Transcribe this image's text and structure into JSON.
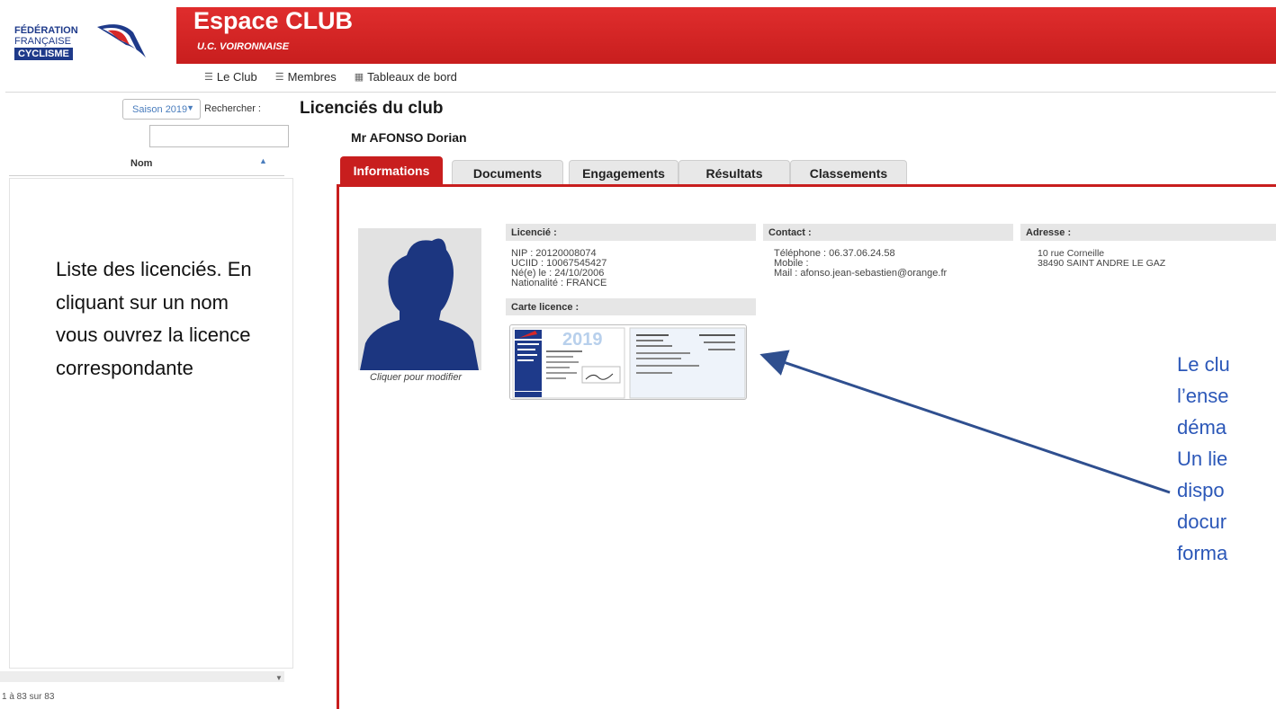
{
  "header": {
    "logo": {
      "line1": "FÉDÉRATION",
      "line2": "FRANÇAISE",
      "line3": "CYCLISME"
    },
    "title": "Espace CLUB",
    "subtitle": "U.C. VOIRONNAISE",
    "brand_color": "#c81e1e"
  },
  "nav": {
    "items": [
      {
        "label": "Le Club",
        "icon": "list-icon"
      },
      {
        "label": "Membres",
        "icon": "list-icon"
      },
      {
        "label": "Tableaux de bord",
        "icon": "grid-icon"
      }
    ]
  },
  "sidebar": {
    "season_select": "Saison 2019",
    "search_label": "Rechercher :",
    "search_value": "",
    "column_header": "Nom",
    "pager": "1 à 83 sur 83",
    "note": "Liste des licenciés. En cliquant sur un nom vous ouvrez la licence correspondante"
  },
  "main": {
    "page_title": "Licenciés du club",
    "person_name": "Mr AFONSO Dorian",
    "tabs": [
      "Informations",
      "Documents",
      "Engagements",
      "Résultats",
      "Classements"
    ],
    "active_tab": "Informations",
    "avatar_caption": "Cliquer pour modifier",
    "licencie": {
      "heading": "Licencié :",
      "nip": "NIP : 20120008074",
      "uciid": "UCIID : 10067545427",
      "birth": "Né(e) le : 24/10/2006",
      "nationality": "Nationalité : FRANCE"
    },
    "contact": {
      "heading": "Contact :",
      "phone": "Téléphone : 06.37.06.24.58",
      "mobile": "Mobile :",
      "mail_label": "Mail :",
      "mail": "afonso.jean-sebastien@orange.fr"
    },
    "address": {
      "heading": "Adresse :",
      "line1": "10 rue Corneille",
      "line2": "38490  SAINT ANDRE LE GAZ"
    },
    "card": {
      "heading": "Carte licence :",
      "year": "2019"
    }
  },
  "annotation_right": {
    "lines": [
      "Le clu",
      "l’ense",
      "déma",
      "Un lie",
      "dispo",
      "docur",
      "forma"
    ]
  }
}
